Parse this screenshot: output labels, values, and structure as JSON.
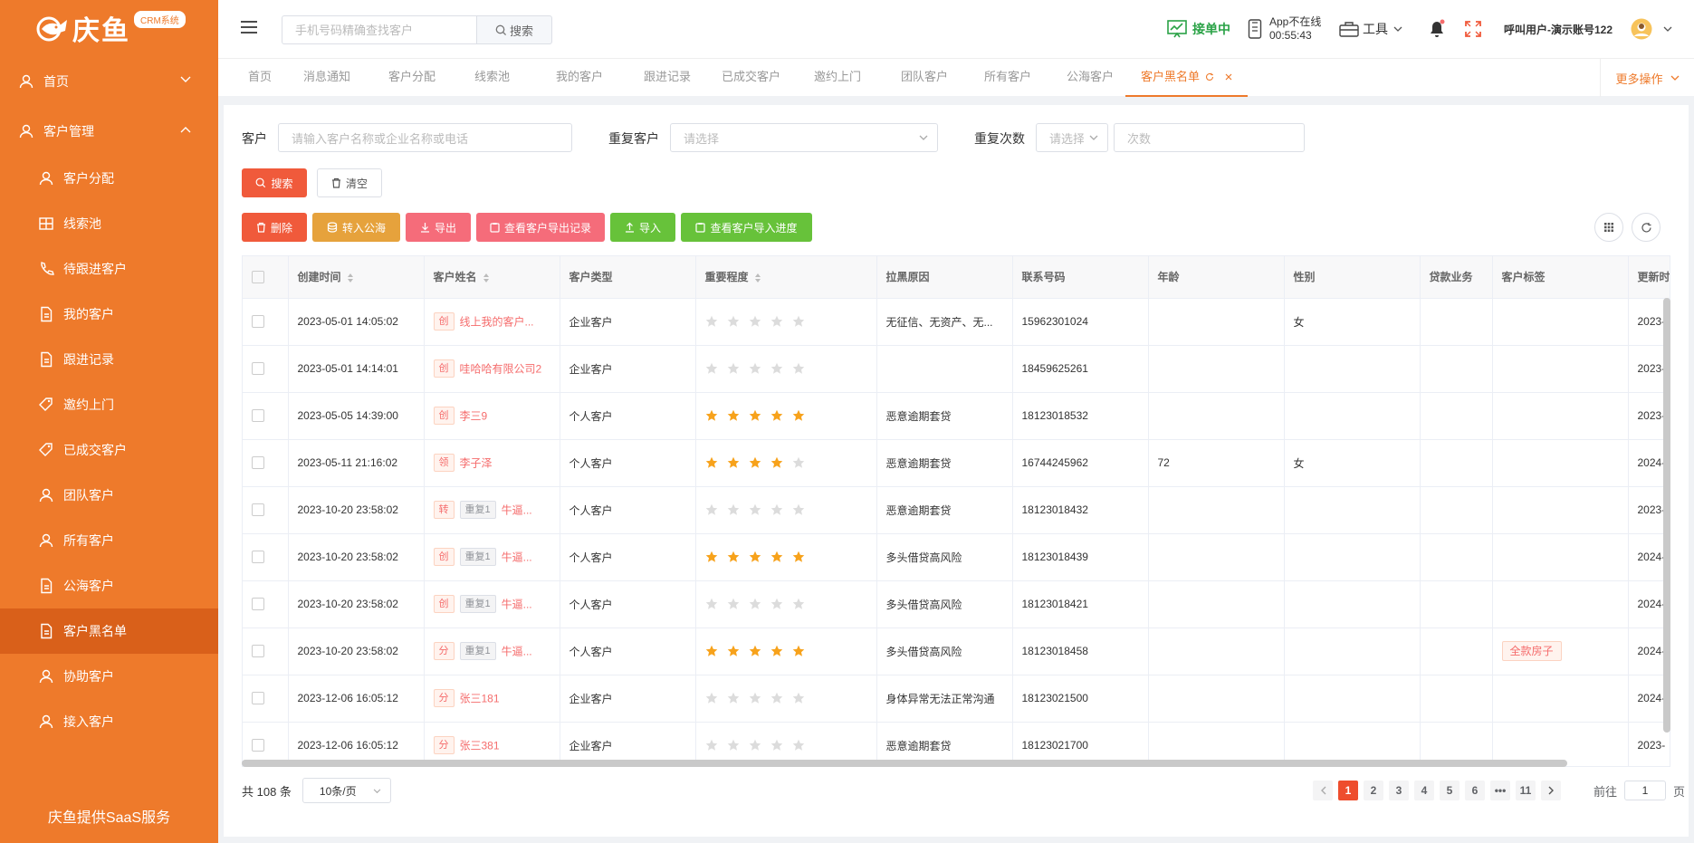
{
  "sidebar": {
    "logo_text": "庆鱼",
    "logo_badge": "CRM系统",
    "home": "首页",
    "customer_mgmt": "客户管理",
    "items": [
      {
        "label": "客户分配",
        "icon": "user-icon"
      },
      {
        "label": "线索池",
        "icon": "grid-icon"
      },
      {
        "label": "待跟进客户",
        "icon": "phone-icon"
      },
      {
        "label": "我的客户",
        "icon": "document-icon"
      },
      {
        "label": "跟进记录",
        "icon": "document-icon"
      },
      {
        "label": "邀约上门",
        "icon": "tag-icon"
      },
      {
        "label": "已成交客户",
        "icon": "tag-icon"
      },
      {
        "label": "团队客户",
        "icon": "user-icon"
      },
      {
        "label": "所有客户",
        "icon": "user-icon"
      },
      {
        "label": "公海客户",
        "icon": "document-icon"
      },
      {
        "label": "客户黑名单",
        "icon": "document-icon",
        "active": true
      },
      {
        "label": "协助客户",
        "icon": "user-icon"
      },
      {
        "label": "接入客户",
        "icon": "user-icon"
      }
    ],
    "footer": "庆鱼提供SaaS服务"
  },
  "header": {
    "search_placeholder": "手机号码精确查找客户",
    "search_btn": "搜索",
    "accepting": "接单中",
    "app_status": "App不在线",
    "app_time": "00:55:43",
    "tools": "工具",
    "user": "呼叫用户-演示账号122"
  },
  "tabs": [
    "首页",
    "消息通知",
    "客户分配",
    "线索池",
    "我的客户",
    "跟进记录",
    "已成交客户",
    "邀约上门",
    "团队客户",
    "所有客户",
    "公海客户",
    "客户黑名单"
  ],
  "more_ops": "更多操作",
  "filters": {
    "customer_label": "客户",
    "customer_placeholder": "请输入客户名称或企业名称或电话",
    "repeat_label": "重复客户",
    "repeat_placeholder": "请选择",
    "repeat_count_label": "重复次数",
    "repeat_count_select": "请选择",
    "count_placeholder": "次数"
  },
  "buttons": {
    "search": "搜索",
    "clear": "清空",
    "delete": "删除",
    "to_pool": "转入公海",
    "export": "导出",
    "export_records": "查看客户导出记录",
    "import": "导入",
    "import_progress": "查看客户导入进度"
  },
  "columns": [
    "创建时间",
    "客户姓名",
    "客户类型",
    "重要程度",
    "拉黑原因",
    "联系号码",
    "年龄",
    "性别",
    "贷款业务",
    "客户标签",
    "更新时间"
  ],
  "rows": [
    {
      "time": "2023-05-01 14:05:02",
      "tag": "创",
      "repeat": "",
      "name": "线上我的客户...",
      "type": "企业客户",
      "stars": 0,
      "reason": "无征信、无资产、无...",
      "phone": "15962301024",
      "age": "",
      "gender": "女",
      "loan": "",
      "ctag": "",
      "updated": "2023-"
    },
    {
      "time": "2023-05-01 14:14:01",
      "tag": "创",
      "repeat": "",
      "name": "哇哈哈有限公司2",
      "type": "企业客户",
      "stars": 0,
      "reason": "",
      "phone": "18459625261",
      "age": "",
      "gender": "",
      "loan": "",
      "ctag": "",
      "updated": "2023-"
    },
    {
      "time": "2023-05-05 14:39:00",
      "tag": "创",
      "repeat": "",
      "name": "李三9",
      "type": "个人客户",
      "stars": 5,
      "reason": "恶意逾期套贷",
      "phone": "18123018532",
      "age": "",
      "gender": "",
      "loan": "",
      "ctag": "",
      "updated": "2023-"
    },
    {
      "time": "2023-05-11 21:16:02",
      "tag": "领",
      "repeat": "",
      "name": "李子泽",
      "type": "个人客户",
      "stars": 4,
      "reason": "恶意逾期套贷",
      "phone": "16744245962",
      "age": "72",
      "gender": "女",
      "loan": "",
      "ctag": "",
      "updated": "2024-"
    },
    {
      "time": "2023-10-20 23:58:02",
      "tag": "转",
      "repeat": "重复1",
      "name": "牛逼...",
      "type": "个人客户",
      "stars": 0,
      "reason": "恶意逾期套贷",
      "phone": "18123018432",
      "age": "",
      "gender": "",
      "loan": "",
      "ctag": "",
      "updated": "2023-"
    },
    {
      "time": "2023-10-20 23:58:02",
      "tag": "创",
      "repeat": "重复1",
      "name": "牛逼...",
      "type": "个人客户",
      "stars": 5,
      "reason": "多头借贷高风险",
      "phone": "18123018439",
      "age": "",
      "gender": "",
      "loan": "",
      "ctag": "",
      "updated": "2024-"
    },
    {
      "time": "2023-10-20 23:58:02",
      "tag": "创",
      "repeat": "重复1",
      "name": "牛逼...",
      "type": "个人客户",
      "stars": 0,
      "reason": "多头借贷高风险",
      "phone": "18123018421",
      "age": "",
      "gender": "",
      "loan": "",
      "ctag": "",
      "updated": "2024-"
    },
    {
      "time": "2023-10-20 23:58:02",
      "tag": "分",
      "repeat": "重复1",
      "name": "牛逼...",
      "type": "个人客户",
      "stars": 5,
      "reason": "多头借贷高风险",
      "phone": "18123018458",
      "age": "",
      "gender": "",
      "loan": "",
      "ctag": "全款房子",
      "updated": "2024-"
    },
    {
      "time": "2023-12-06 16:05:12",
      "tag": "分",
      "repeat": "",
      "name": "张三181",
      "type": "企业客户",
      "stars": 0,
      "reason": "身体异常无法正常沟通",
      "phone": "18123021500",
      "age": "",
      "gender": "",
      "loan": "",
      "ctag": "",
      "updated": "2024-"
    },
    {
      "time": "2023-12-06 16:05:12",
      "tag": "分",
      "repeat": "",
      "name": "张三381",
      "type": "企业客户",
      "stars": 0,
      "reason": "恶意逾期套贷",
      "phone": "18123021700",
      "age": "",
      "gender": "",
      "loan": "",
      "ctag": "",
      "updated": "2023-"
    }
  ],
  "pagination": {
    "total": "共 108 条",
    "page_size": "10条/页",
    "pages": [
      "1",
      "2",
      "3",
      "4",
      "5",
      "6",
      "•••",
      "11"
    ],
    "current": "1",
    "goto_label": "前往",
    "goto_value": "1",
    "goto_suffix": "页"
  },
  "colors": {
    "accent": "#ee7a2b",
    "primary": "#f05a3b",
    "star": "#f7a21b",
    "green": "#67c23a",
    "pink": "#f56c7a",
    "amber": "#e6a23c"
  }
}
